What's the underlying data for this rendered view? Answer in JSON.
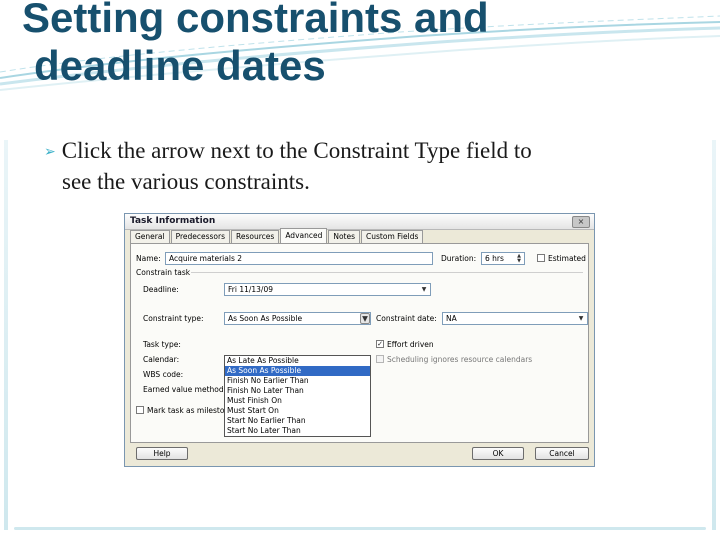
{
  "slide": {
    "title_line1": "Setting constraints and",
    "title_line2": "deadline dates",
    "bullet_line1": "Click the arrow next to the Constraint Type field to",
    "bullet_line2": "see the various constraints.",
    "accent_color": "#17506e",
    "bullet_color": "#3ab0c8"
  },
  "dialog": {
    "title": "Task Information",
    "close_glyph": "×",
    "tabs": [
      "General",
      "Predecessors",
      "Resources",
      "Advanced",
      "Notes",
      "Custom Fields"
    ],
    "active_tab": "Advanced",
    "name_label": "Name:",
    "name_value": "Acquire materials 2",
    "duration_label": "Duration:",
    "duration_value": "6 hrs",
    "estimated_label": "Estimated",
    "group_label": "Constrain task",
    "deadline_label": "Deadline:",
    "deadline_value": "Fri 11/13/09",
    "constraint_type_label": "Constraint type:",
    "constraint_type_value": "As Soon As Possible",
    "constraint_date_label": "Constraint date:",
    "constraint_date_value": "NA",
    "task_type_label": "Task type:",
    "calendar_label": "Calendar:",
    "wbs_label": "WBS code:",
    "earned_value_label": "Earned value method:",
    "effort_driven_label": "Effort driven",
    "scheduling_label": "Scheduling ignores resource calendars",
    "milestone_label": "Mark task as milestone",
    "dropdown_options": [
      "As Late As Possible",
      "As Soon As Possible",
      "Finish No Earlier Than",
      "Finish No Later Than",
      "Must Finish On",
      "Must Start On",
      "Start No Earlier Than",
      "Start No Later Than"
    ],
    "selected_option_index": 1,
    "help_label": "Help",
    "ok_label": "OK",
    "cancel_label": "Cancel",
    "check_glyph": "✓",
    "arrow_glyph": "▼"
  }
}
